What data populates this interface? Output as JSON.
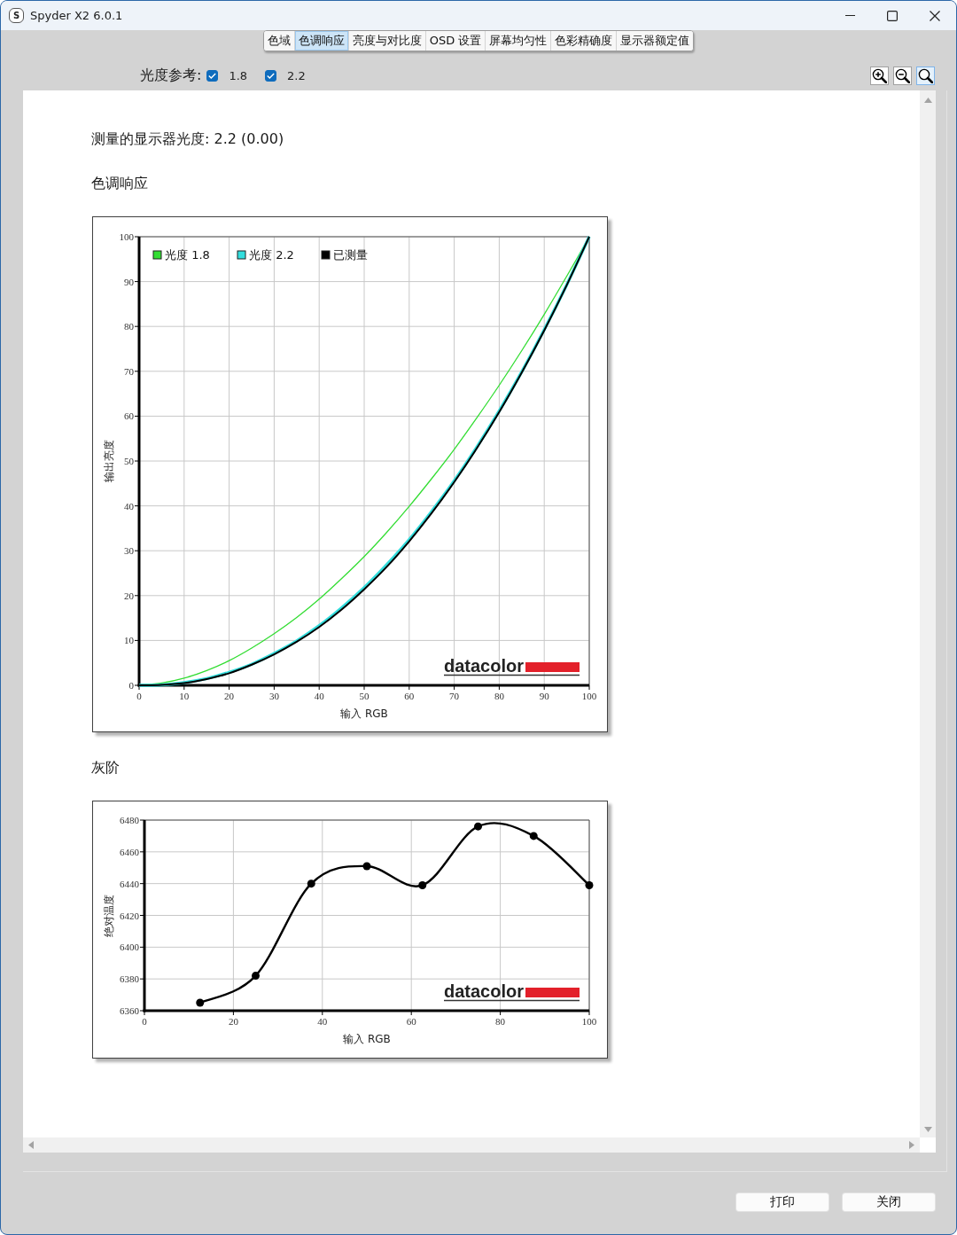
{
  "window": {
    "icon_letter": "S",
    "title": "Spyder X2 6.0.1"
  },
  "tabs": [
    {
      "label": "色域",
      "selected": false
    },
    {
      "label": "色调响应",
      "selected": true
    },
    {
      "label": "亮度与对比度",
      "selected": false
    },
    {
      "label": "OSD 设置",
      "selected": false
    },
    {
      "label": "屏幕均匀性",
      "selected": false
    },
    {
      "label": "色彩精确度",
      "selected": false
    },
    {
      "label": "显示器额定值",
      "selected": false
    }
  ],
  "gamma_reference": {
    "label": "光度参考:",
    "options": [
      {
        "label": "1.8",
        "checked": true
      },
      {
        "label": "2.2",
        "checked": true
      }
    ]
  },
  "zoom_tools": [
    {
      "kind": "zoom-in",
      "selected": false
    },
    {
      "kind": "zoom-out",
      "selected": false
    },
    {
      "kind": "zoom-fit",
      "selected": true
    }
  ],
  "report": {
    "measured_gamma": "测量的显示器光度: 2.2 (0.00)",
    "sections": [
      {
        "kind": "tone",
        "title": "色调响应",
        "logo": "datacolor",
        "chart_data": {
          "type": "line",
          "xlabel": "输入 RGB",
          "ylabel": "输出亮度",
          "grid": true,
          "legend": "upper left",
          "x": [
            0,
            5,
            10,
            15,
            20,
            25,
            30,
            35,
            40,
            45,
            50,
            55,
            60,
            65,
            70,
            75,
            80,
            85,
            90,
            95,
            100
          ],
          "series": [
            {
              "name": "光度 1.8",
              "color": "#33dd33",
              "values": [
                0,
                0.5,
                1.6,
                3.3,
                5.5,
                8.3,
                11.5,
                15.1,
                19.2,
                23.8,
                28.7,
                34.1,
                39.9,
                46.1,
                52.6,
                59.6,
                66.9,
                74.6,
                82.7,
                91.2,
                100
              ]
            },
            {
              "name": "光度 2.2",
              "color": "#33dddd",
              "values": [
                0,
                0.1,
                0.6,
                1.5,
                2.9,
                4.7,
                7.1,
                9.9,
                13.3,
                17.3,
                21.8,
                26.9,
                32.5,
                38.8,
                45.6,
                53.1,
                61.2,
                69.9,
                79.3,
                89.3,
                100
              ]
            },
            {
              "name": "已测量",
              "color": "#000000",
              "values": [
                0,
                0.1,
                0.5,
                1.4,
                2.7,
                4.6,
                6.9,
                9.7,
                13.0,
                16.9,
                21.4,
                26.4,
                32.1,
                38.4,
                45.3,
                52.8,
                60.9,
                69.7,
                79.1,
                89.2,
                100
              ]
            }
          ],
          "xlim": [
            0,
            100
          ],
          "ylim": [
            0,
            100
          ],
          "xticks": [
            0,
            10,
            20,
            30,
            40,
            50,
            60,
            70,
            80,
            90,
            100
          ],
          "yticks": [
            0,
            10,
            20,
            30,
            40,
            50,
            60,
            70,
            80,
            90,
            100
          ]
        }
      },
      {
        "kind": "grayscale",
        "title": "灰阶",
        "logo": "datacolor",
        "chart_data": {
          "type": "line",
          "xlabel": "输入 RGB",
          "ylabel": "绝对温度",
          "grid": true,
          "x": [
            12.5,
            25,
            37.5,
            50,
            62.5,
            75,
            87.5,
            100
          ],
          "series": [
            {
              "color": "#000000",
              "marker": "circle",
              "values": [
                6365,
                6382,
                6440,
                6451,
                6439,
                6476,
                6470,
                6439
              ]
            }
          ],
          "xlim": [
            0,
            100
          ],
          "ylim": [
            6360,
            6480
          ],
          "xticks": [
            0,
            20,
            40,
            60,
            80,
            100
          ],
          "yticks": [
            6360,
            6380,
            6400,
            6420,
            6440,
            6460,
            6480
          ]
        }
      }
    ]
  },
  "buttons": [
    {
      "label": "打印"
    },
    {
      "label": "关闭"
    }
  ]
}
